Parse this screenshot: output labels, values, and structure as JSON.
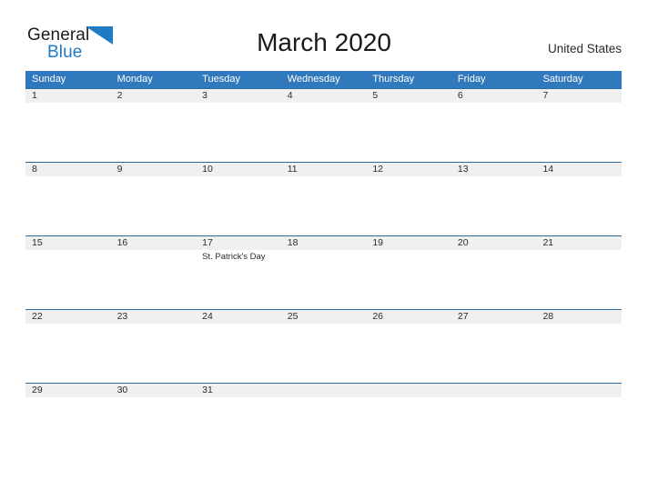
{
  "brand": {
    "name_part1": "General",
    "name_part2": "Blue",
    "triangle_icon": "triangle-logo-icon",
    "color_dark": "#1c1c1c",
    "color_blue": "#1f7ac4"
  },
  "header": {
    "title": "March 2020",
    "region": "United States"
  },
  "calendar": {
    "accent_color": "#3179bd",
    "row_line_color": "#2e6da4",
    "date_band_color": "#f0f0f0",
    "day_headers": [
      "Sunday",
      "Monday",
      "Tuesday",
      "Wednesday",
      "Thursday",
      "Friday",
      "Saturday"
    ],
    "weeks": [
      {
        "days": [
          {
            "date": "1",
            "event": ""
          },
          {
            "date": "2",
            "event": ""
          },
          {
            "date": "3",
            "event": ""
          },
          {
            "date": "4",
            "event": ""
          },
          {
            "date": "5",
            "event": ""
          },
          {
            "date": "6",
            "event": ""
          },
          {
            "date": "7",
            "event": ""
          }
        ]
      },
      {
        "days": [
          {
            "date": "8",
            "event": ""
          },
          {
            "date": "9",
            "event": ""
          },
          {
            "date": "10",
            "event": ""
          },
          {
            "date": "11",
            "event": ""
          },
          {
            "date": "12",
            "event": ""
          },
          {
            "date": "13",
            "event": ""
          },
          {
            "date": "14",
            "event": ""
          }
        ]
      },
      {
        "days": [
          {
            "date": "15",
            "event": ""
          },
          {
            "date": "16",
            "event": ""
          },
          {
            "date": "17",
            "event": "St. Patrick's Day"
          },
          {
            "date": "18",
            "event": ""
          },
          {
            "date": "19",
            "event": ""
          },
          {
            "date": "20",
            "event": ""
          },
          {
            "date": "21",
            "event": ""
          }
        ]
      },
      {
        "days": [
          {
            "date": "22",
            "event": ""
          },
          {
            "date": "23",
            "event": ""
          },
          {
            "date": "24",
            "event": ""
          },
          {
            "date": "25",
            "event": ""
          },
          {
            "date": "26",
            "event": ""
          },
          {
            "date": "27",
            "event": ""
          },
          {
            "date": "28",
            "event": ""
          }
        ]
      },
      {
        "days": [
          {
            "date": "29",
            "event": ""
          },
          {
            "date": "30",
            "event": ""
          },
          {
            "date": "31",
            "event": ""
          },
          {
            "date": "",
            "event": ""
          },
          {
            "date": "",
            "event": ""
          },
          {
            "date": "",
            "event": ""
          },
          {
            "date": "",
            "event": ""
          }
        ]
      }
    ]
  }
}
